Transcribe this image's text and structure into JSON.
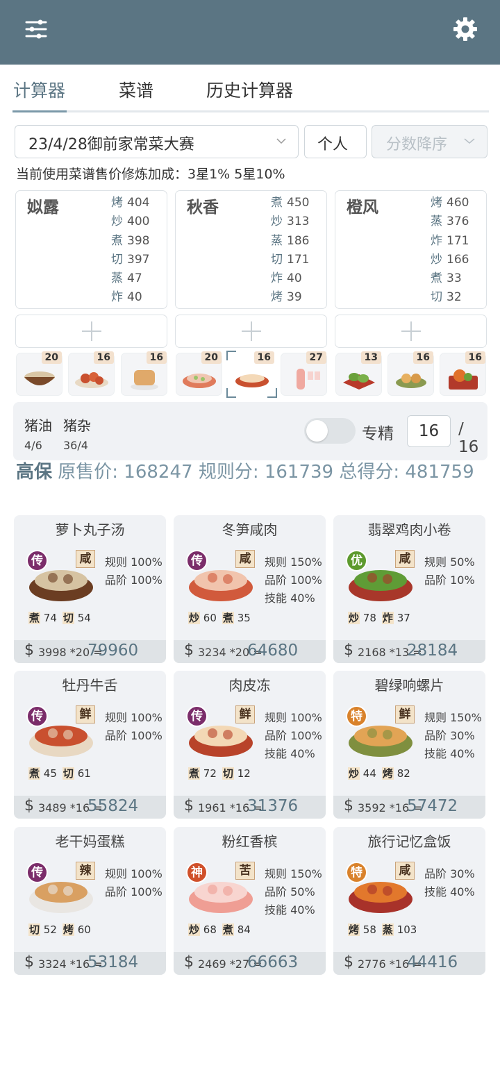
{
  "header": {
    "filter_icon": "filter-icon",
    "settings_icon": "gear-icon"
  },
  "tabs": [
    {
      "label": "计算器"
    },
    {
      "label": "菜谱"
    },
    {
      "label": "历史计算器"
    }
  ],
  "controls": {
    "rule_select": "23/4/28御前家常菜大赛",
    "mode_select": "个人",
    "sort_select": "分数降序"
  },
  "note": "当前使用菜谱售价修炼加成：3星1% 5星10%",
  "chefs": [
    {
      "name": "姒露",
      "skills": [
        {
          "k": "烤",
          "v": "404"
        },
        {
          "k": "炒",
          "v": "400"
        },
        {
          "k": "煮",
          "v": "398"
        },
        {
          "k": "切",
          "v": "397"
        },
        {
          "k": "蒸",
          "v": "47"
        },
        {
          "k": "炸",
          "v": "40"
        }
      ]
    },
    {
      "name": "秋香",
      "skills": [
        {
          "k": "煮",
          "v": "450"
        },
        {
          "k": "炒",
          "v": "313"
        },
        {
          "k": "蒸",
          "v": "186"
        },
        {
          "k": "切",
          "v": "171"
        },
        {
          "k": "炸",
          "v": "40"
        },
        {
          "k": "烤",
          "v": "39"
        }
      ]
    },
    {
      "name": "橙风",
      "skills": [
        {
          "k": "烤",
          "v": "460"
        },
        {
          "k": "蒸",
          "v": "376"
        },
        {
          "k": "炸",
          "v": "171"
        },
        {
          "k": "炒",
          "v": "166"
        },
        {
          "k": "煮",
          "v": "33"
        },
        {
          "k": "切",
          "v": "32"
        }
      ]
    }
  ],
  "thumb_counts": [
    "20",
    "16",
    "16",
    "20",
    "16",
    "27",
    "13",
    "16",
    "16"
  ],
  "ingredients": [
    {
      "name": "猪油",
      "count": "4/6"
    },
    {
      "name": "猪杂",
      "count": "36/4"
    }
  ],
  "specialize": {
    "label": "专精",
    "level": "16",
    "max": "/ 16",
    "enabled": false
  },
  "summary": {
    "chef": "高保",
    "text": "原售价: 168247 规则分: 161739 总得分: 481759"
  },
  "recipes": [
    {
      "name": "萝卜丸子汤",
      "rarity": "传",
      "flavor": "咸",
      "bonus": [
        "规则 100%",
        "品阶 100%"
      ],
      "req": [
        {
          "k": "煮",
          "v": "74"
        },
        {
          "k": "切",
          "v": "54"
        }
      ],
      "formula": "3998 *20 =",
      "total": "79960"
    },
    {
      "name": "冬笋咸肉",
      "rarity": "传",
      "flavor": "咸",
      "bonus": [
        "规则 150%",
        "品阶 100%",
        "技能 40%"
      ],
      "req": [
        {
          "k": "炒",
          "v": "60"
        },
        {
          "k": "煮",
          "v": "35"
        }
      ],
      "formula": "3234 *20 =",
      "total": "64680"
    },
    {
      "name": "翡翠鸡肉小卷",
      "rarity": "优",
      "flavor": "咸",
      "bonus": [
        "规则 50%",
        "品阶 10%"
      ],
      "req": [
        {
          "k": "炒",
          "v": "78"
        },
        {
          "k": "炸",
          "v": "37"
        }
      ],
      "formula": "2168 *13 =",
      "total": "28184"
    },
    {
      "name": "牡丹牛舌",
      "rarity": "传",
      "flavor": "鲜",
      "bonus": [
        "规则 100%",
        "品阶 100%"
      ],
      "req": [
        {
          "k": "煮",
          "v": "45"
        },
        {
          "k": "切",
          "v": "61"
        }
      ],
      "formula": "3489 *16 =",
      "total": "55824"
    },
    {
      "name": "肉皮冻",
      "rarity": "传",
      "flavor": "鲜",
      "bonus": [
        "规则 100%",
        "品阶 100%",
        "技能 40%"
      ],
      "req": [
        {
          "k": "煮",
          "v": "72"
        },
        {
          "k": "切",
          "v": "12"
        }
      ],
      "formula": "1961 *16 =",
      "total": "31376"
    },
    {
      "name": "碧绿响螺片",
      "rarity": "特",
      "flavor": "鲜",
      "bonus": [
        "规则 150%",
        "品阶 30%",
        "技能 40%"
      ],
      "req": [
        {
          "k": "炒",
          "v": "44"
        },
        {
          "k": "烤",
          "v": "82"
        }
      ],
      "formula": "3592 *16 =",
      "total": "57472"
    },
    {
      "name": "老干妈蛋糕",
      "rarity": "传",
      "flavor": "辣",
      "bonus": [
        "规则 100%",
        "品阶 100%"
      ],
      "req": [
        {
          "k": "切",
          "v": "52"
        },
        {
          "k": "烤",
          "v": "60"
        }
      ],
      "formula": "3324 *16 =",
      "total": "53184"
    },
    {
      "name": "粉红香槟",
      "rarity": "神",
      "flavor": "苦",
      "bonus": [
        "规则 150%",
        "品阶 50%",
        "技能 40%"
      ],
      "req": [
        {
          "k": "炒",
          "v": "68"
        },
        {
          "k": "煮",
          "v": "84"
        }
      ],
      "formula": "2469 *27 =",
      "total": "66663"
    },
    {
      "name": "旅行记忆盒饭",
      "rarity": "特",
      "flavor": "咸",
      "bonus": [
        "品阶 30%",
        "技能 40%"
      ],
      "req": [
        {
          "k": "烤",
          "v": "58"
        },
        {
          "k": "蒸",
          "v": "103"
        }
      ],
      "formula": "2776 *16 =",
      "total": "44416"
    }
  ],
  "rarity_colors": {
    "传": "#7b2d6a",
    "优": "#5d9a2e",
    "特": "#d9822b",
    "神": "#d0502a"
  },
  "colors": {
    "appbar": "#5b7583",
    "accent": "#5b7583"
  }
}
